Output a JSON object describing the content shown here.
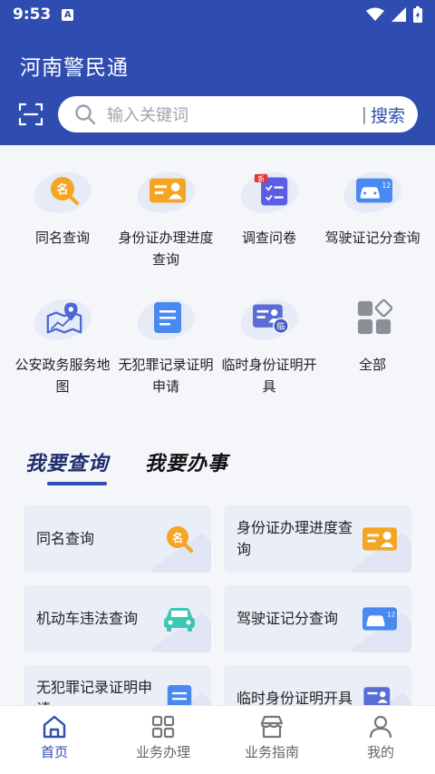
{
  "status_bar": {
    "time": "9:53",
    "a_icon": "A"
  },
  "header": {
    "title": "河南警民通",
    "search_placeholder": "输入关键词",
    "search_divider": "|",
    "search_button": "搜索"
  },
  "grid": [
    {
      "label": "同名查询",
      "icon": "name-search-icon"
    },
    {
      "label": "身份证办理进度查询",
      "icon": "id-card-icon"
    },
    {
      "label": "调查问卷",
      "icon": "survey-icon",
      "badge": "新"
    },
    {
      "label": "驾驶证记分查询",
      "icon": "driver-license-icon",
      "icon_text": "12"
    },
    {
      "label": "公安政务服务地图",
      "icon": "map-icon"
    },
    {
      "label": "无犯罪记录证明申请",
      "icon": "document-icon"
    },
    {
      "label": "临时身份证明开具",
      "icon": "temp-id-icon",
      "icon_text": "临"
    },
    {
      "label": "全部",
      "icon": "all-icon"
    }
  ],
  "tabs": {
    "query": "我要查询",
    "service": "我要办事"
  },
  "cards": [
    {
      "label": "同名查询"
    },
    {
      "label": "身份证办理进度查询"
    },
    {
      "label": "机动车违法查询"
    },
    {
      "label": "驾驶证记分查询"
    },
    {
      "label": "无犯罪记录证明申请"
    },
    {
      "label": "临时身份证明开具"
    }
  ],
  "name_icon_text": "名",
  "bottom_nav": [
    {
      "label": "首页",
      "active": true
    },
    {
      "label": "业务办理"
    },
    {
      "label": "业务指南"
    },
    {
      "label": "我的"
    }
  ],
  "colors": {
    "primary": "#2f4db0",
    "orange": "#f5a524",
    "blue_icon": "#4a8af0",
    "teal": "#3ec6b4"
  }
}
